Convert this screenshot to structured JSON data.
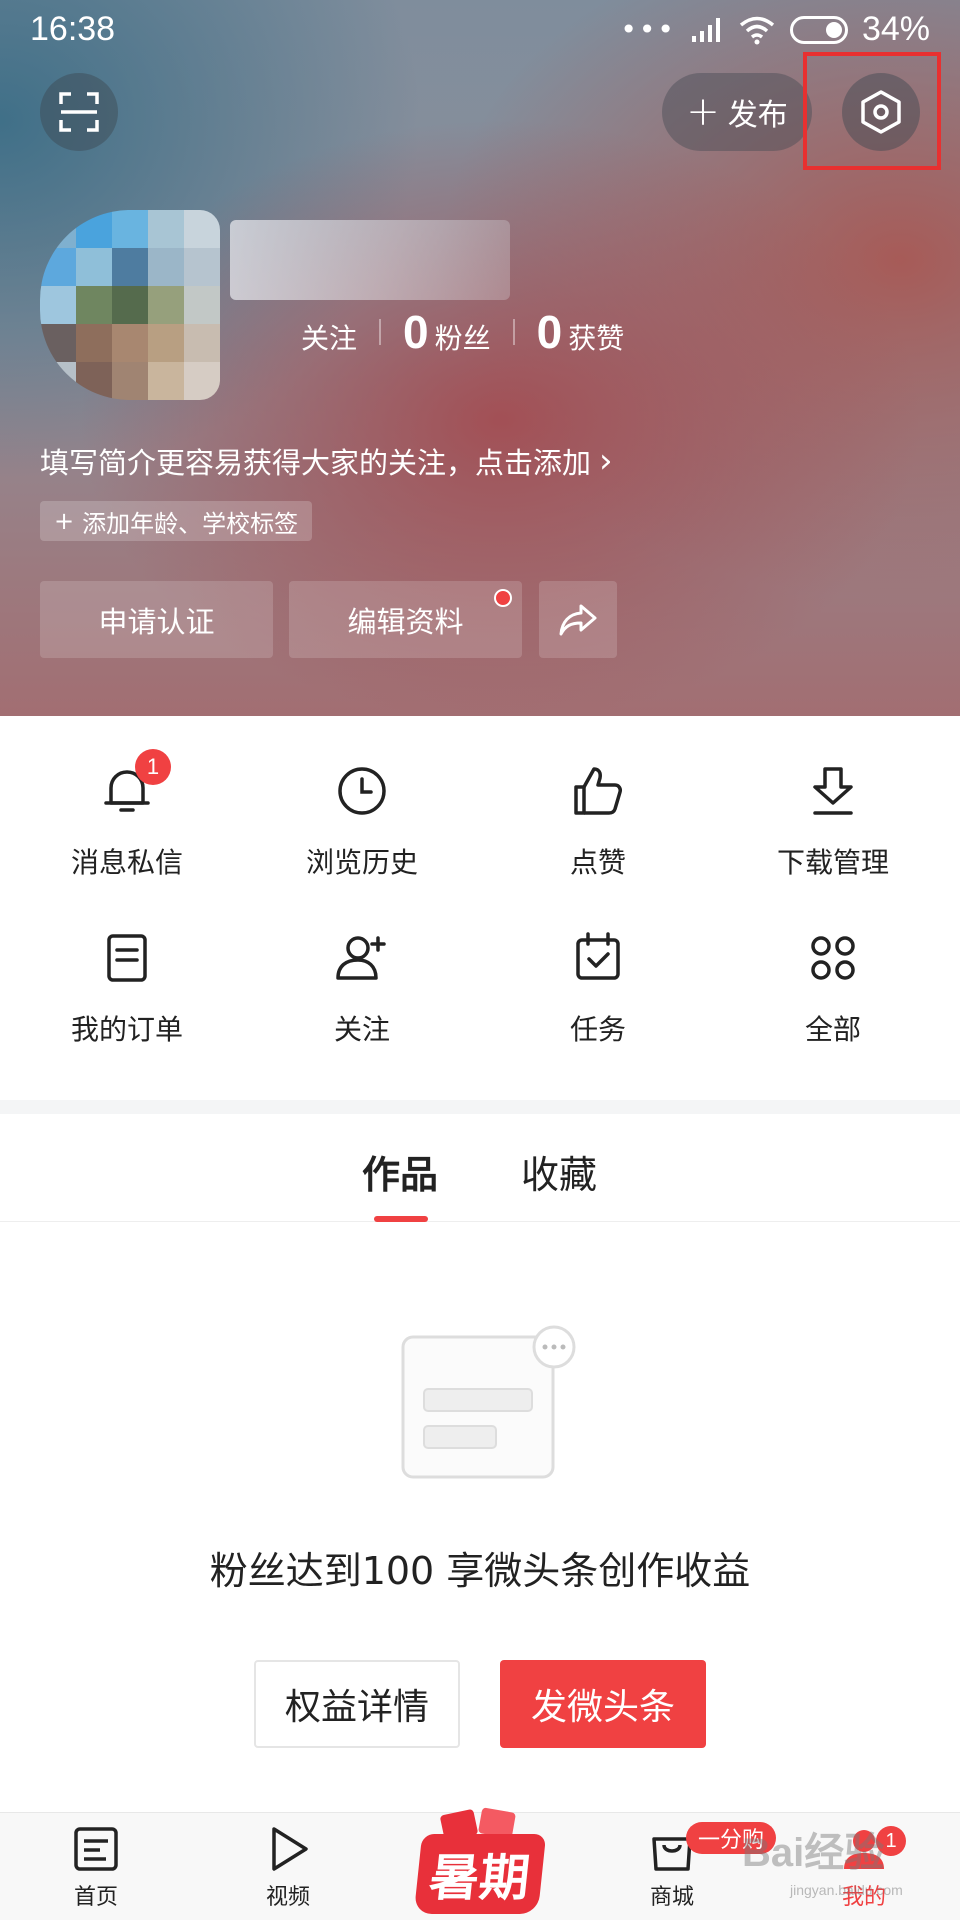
{
  "status_bar": {
    "time": "16:38",
    "signal_dots": "•••",
    "battery": "34%"
  },
  "header": {
    "publish_label": "发布",
    "stats": [
      {
        "num": "",
        "label": "关注"
      },
      {
        "num": "0",
        "label": "粉丝"
      },
      {
        "num": "0",
        "label": "获赞"
      }
    ],
    "bio_prompt": "填写简介更容易获得大家的关注，点击添加",
    "tag_chip": "添加年龄、学校标签",
    "buttons": {
      "verify": "申请认证",
      "edit_profile": "编辑资料"
    }
  },
  "features": [
    {
      "label": "消息私信",
      "icon": "bell-icon",
      "badge": "1"
    },
    {
      "label": "浏览历史",
      "icon": "clock-icon"
    },
    {
      "label": "点赞",
      "icon": "thumbs-up-icon"
    },
    {
      "label": "下载管理",
      "icon": "download-icon"
    },
    {
      "label": "我的订单",
      "icon": "order-icon"
    },
    {
      "label": "关注",
      "icon": "add-user-icon"
    },
    {
      "label": "任务",
      "icon": "calendar-check-icon"
    },
    {
      "label": "全部",
      "icon": "grid-icon"
    }
  ],
  "tabs": [
    {
      "label": "作品",
      "active": true
    },
    {
      "label": "收藏",
      "active": false
    }
  ],
  "empty_state": {
    "message": "粉丝达到100 享微头条创作收益",
    "secondary_button": "权益详情",
    "primary_button": "发微头条"
  },
  "bottom_nav": [
    {
      "label": "首页",
      "icon": "home-article-icon"
    },
    {
      "label": "视频",
      "icon": "play-icon"
    },
    {
      "label": "暑期",
      "icon": "summer-promo-icon"
    },
    {
      "label": "商城",
      "icon": "shopping-bag-icon",
      "badge": "一分购"
    },
    {
      "label": "我的",
      "icon": "profile-icon",
      "badge": "1",
      "active": true
    }
  ],
  "watermark": {
    "text": "Bai经验",
    "sub": "jingyan.baidu.com"
  },
  "colors": {
    "accent": "#f04142",
    "highlight_box": "#e83030"
  }
}
